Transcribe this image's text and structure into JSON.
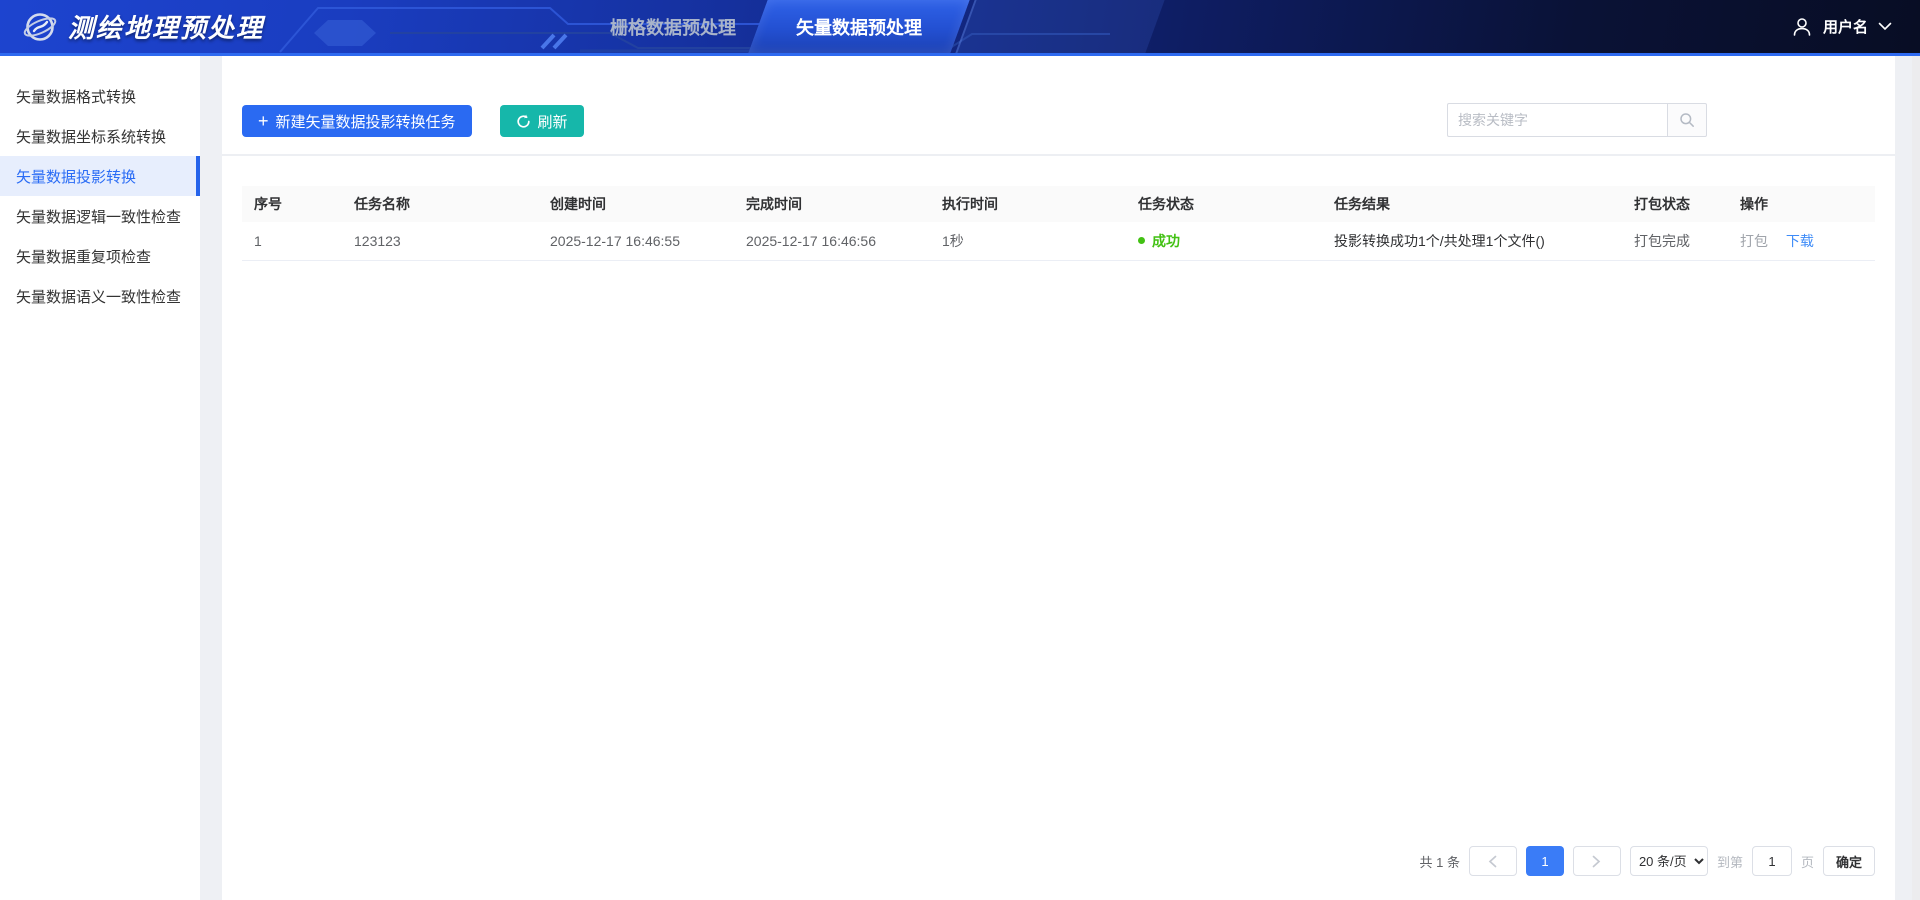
{
  "header": {
    "app_title": "测绘地理预处理",
    "tabs": [
      {
        "label": "栅格数据预处理",
        "active": false
      },
      {
        "label": "矢量数据预处理",
        "active": true
      }
    ],
    "user": {
      "name": "用户名"
    }
  },
  "sidebar": {
    "items": [
      {
        "label": "矢量数据格式转换",
        "active": false
      },
      {
        "label": "矢量数据坐标系统转换",
        "active": false
      },
      {
        "label": "矢量数据投影转换",
        "active": true
      },
      {
        "label": "矢量数据逻辑一致性检查",
        "active": false
      },
      {
        "label": "矢量数据重复项检查",
        "active": false
      },
      {
        "label": "矢量数据语义一致性检查",
        "active": false
      }
    ]
  },
  "toolbar": {
    "new_task_label": "新建矢量数据投影转换任务",
    "refresh_label": "刷新",
    "search_placeholder": "搜索关键字"
  },
  "table": {
    "columns": [
      "序号",
      "任务名称",
      "创建时间",
      "完成时间",
      "执行时间",
      "任务状态",
      "任务结果",
      "打包状态",
      "操作"
    ],
    "rows": [
      {
        "index": "1",
        "name": "123123",
        "created": "2025-12-17 16:46:55",
        "finished": "2025-12-17 16:46:56",
        "duration": "1秒",
        "status": "成功",
        "result": "投影转换成功1个/共处理1个文件()",
        "package_status": "打包完成",
        "actions": {
          "package": "打包",
          "download": "下载"
        }
      }
    ]
  },
  "pagination": {
    "total_text": "共 1 条",
    "current_page": "1",
    "page_size_label": "20 条/页",
    "goto_prefix": "到第",
    "goto_value": "1",
    "goto_suffix": "页",
    "confirm_label": "确定"
  },
  "colors": {
    "primary_blue": "#2a6af2",
    "header_border_blue": "#2e6af0",
    "refresh_teal": "#16b7aa",
    "success_green": "#42c113",
    "link_blue": "#3d8bf8",
    "active_page_blue": "#3a7cf7",
    "sidebar_active_bg": "#e7eefd"
  }
}
